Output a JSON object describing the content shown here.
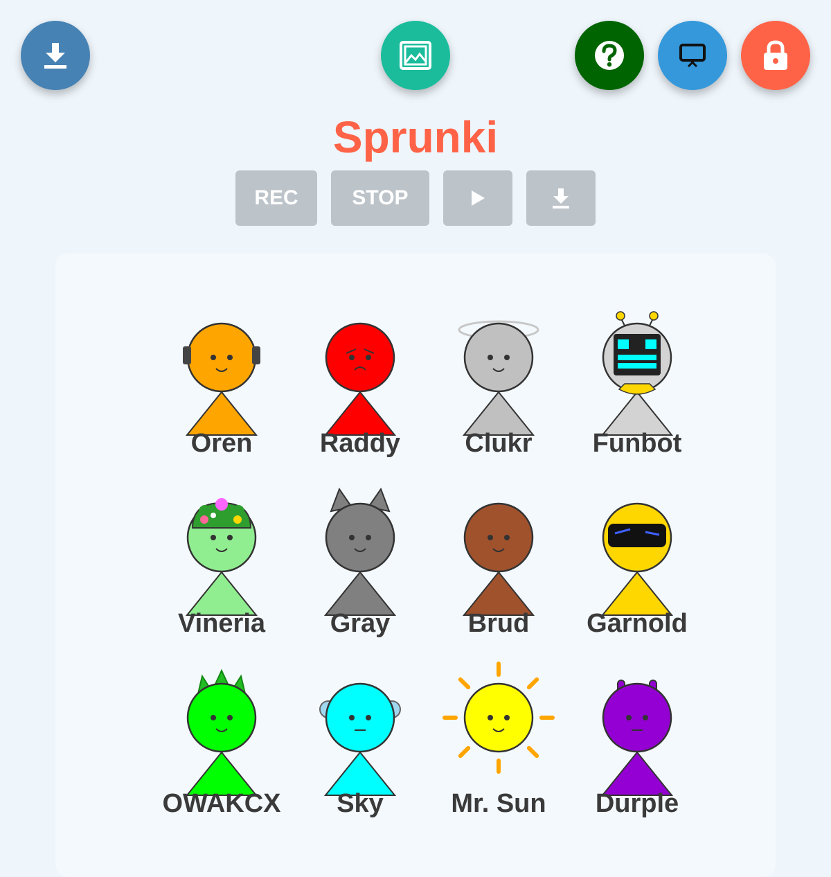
{
  "toolbar": {
    "download_icon": "download-icon",
    "gallery_icon": "image-icon",
    "help_icon": "question-icon",
    "screen_icon": "monitor-icon",
    "lock_icon": "lock-icon",
    "colors": {
      "download": "#4682b4",
      "gallery": "#1abc9c",
      "help": "#006400",
      "screen": "#3498db",
      "lock": "#ff6347"
    }
  },
  "header": {
    "title": "Sprunki",
    "title_color": "#ff6347"
  },
  "recorder": {
    "rec_label": "REC",
    "stop_label": "STOP",
    "play_icon": "play-icon",
    "save_icon": "download-icon"
  },
  "characters": [
    {
      "name": "Oren",
      "color": "#ffa500"
    },
    {
      "name": "Raddy",
      "color": "#ff0000"
    },
    {
      "name": "Clukr",
      "color": "#c0c0c0"
    },
    {
      "name": "Funbot",
      "color": "#d3d3d3"
    },
    {
      "name": "Vineria",
      "color": "#90ee90"
    },
    {
      "name": "Gray",
      "color": "#808080"
    },
    {
      "name": "Brud",
      "color": "#a0522d"
    },
    {
      "name": "Garnold",
      "color": "#ffd700"
    },
    {
      "name": "OWAKCX",
      "color": "#00ff00"
    },
    {
      "name": "Sky",
      "color": "#00ffff"
    },
    {
      "name": "Mr. Sun",
      "color": "#ffff00"
    },
    {
      "name": "Durple",
      "color": "#9400d3"
    }
  ]
}
